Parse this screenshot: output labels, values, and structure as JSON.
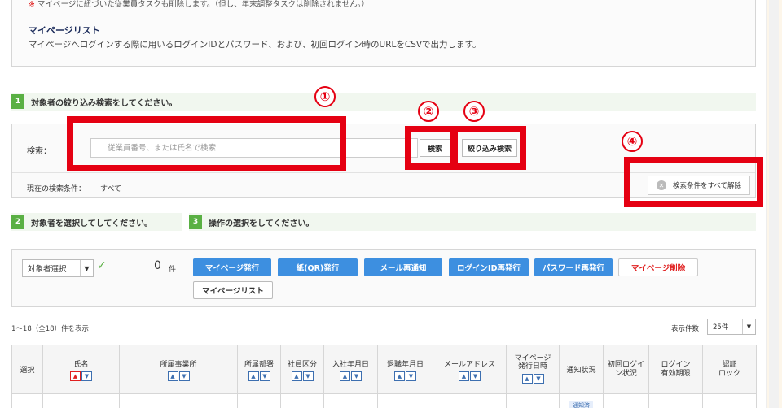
{
  "info": {
    "note_mark": "※",
    "note": "マイページに紐づいた従業員タスクも削除します。（但し、年末調整タスクは削除されません。）",
    "title": "マイページリスト",
    "desc": "マイページへログインする際に用いるログインIDとパスワード、および、初回ログイン時のURLをCSVで出力します。"
  },
  "steps": [
    {
      "num": "1",
      "label": "対象者の絞り込み検索をしてください。"
    },
    {
      "num": "2",
      "label": "対象者を選択してしてください。"
    },
    {
      "num": "3",
      "label": "操作の選択をしてください。"
    }
  ],
  "search": {
    "label": "検索：",
    "placeholder": "従業員番号、または氏名で検索",
    "value": "",
    "search_button": "検索",
    "filter_button": "絞り込み検索",
    "condition_label": "現在の検索条件：",
    "condition_value": "すべて",
    "clear_button": "検索条件をすべて解除"
  },
  "annotations": [
    "①",
    "②",
    "③",
    "④"
  ],
  "selection": {
    "select_value": "対象者選択",
    "count": "0",
    "count_unit": "件"
  },
  "actions": [
    "マイページ発行",
    "紙(QR)発行",
    "メール再通知",
    "ログインID再発行",
    "パスワード再発行",
    "マイページ削除",
    "マイページリスト"
  ],
  "list": {
    "range": "1〜18（全18）件を表示",
    "per_page_label": "表示件数",
    "per_page_value": "25件"
  },
  "table": {
    "columns": [
      "選択",
      "氏名",
      "所属事業所",
      "所属部署",
      "社員区分",
      "入社年月日",
      "退職年月日",
      "メールアドレス",
      "マイページ\n発行日時",
      "通知状況",
      "初回ログイ\nン状況",
      "ログイン\n有効期限",
      "認証\nロック"
    ],
    "row_badge": "通知済"
  },
  "colors": {
    "accent": "#3d8fe0",
    "highlight": "#e50012",
    "step": "#5ab044"
  }
}
